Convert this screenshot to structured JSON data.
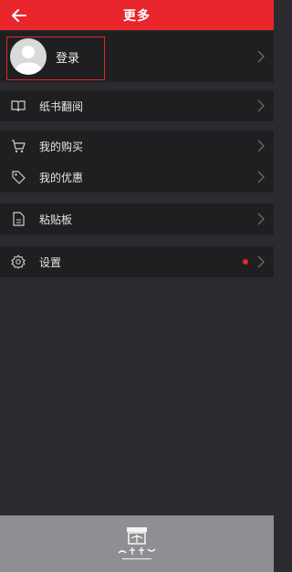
{
  "header": {
    "title": "更多",
    "back_icon": "arrow-left-icon"
  },
  "profile": {
    "login_label": "登录",
    "avatar_icon": "user-avatar-icon"
  },
  "menu": [
    {
      "label": "纸书翻阅",
      "icon": "book-open-icon"
    },
    {
      "label": "我的购买",
      "icon": "cart-icon"
    },
    {
      "label": "我的优惠",
      "icon": "tag-icon"
    },
    {
      "label": "粘贴板",
      "icon": "document-icon"
    },
    {
      "label": "设置",
      "icon": "gear-icon"
    }
  ],
  "footer": {
    "logo_text": "商務印書館",
    "logo_subtext": "The Commercial Press",
    "logo_year": "始于1897"
  },
  "colors": {
    "accent": "#e8262b",
    "background": "#2b2b2f",
    "row_background": "#1f1f21",
    "footer": "#8e8e93"
  }
}
